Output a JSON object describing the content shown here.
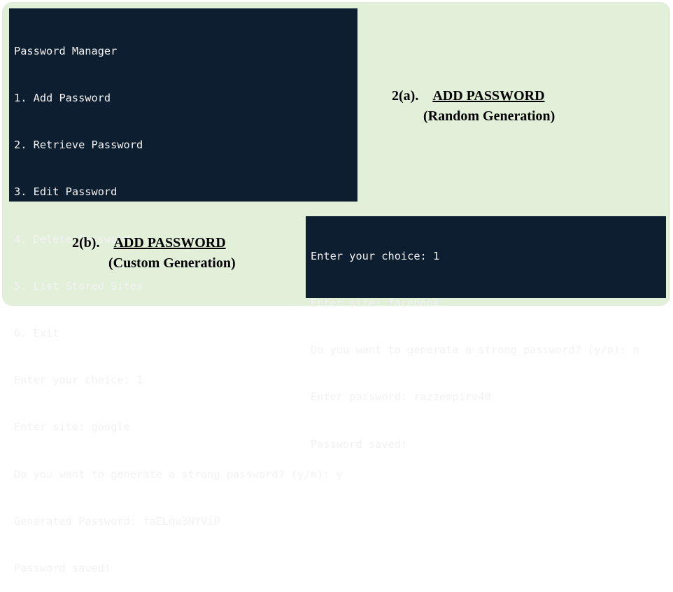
{
  "section_a": {
    "number": "2(a).",
    "title": "ADD PASSWORD",
    "subtitle": "(Random Generation)",
    "terminal_lines": [
      "Password Manager",
      "1. Add Password",
      "2. Retrieve Password",
      "3. Edit Password",
      "4. Delete Password",
      "5. List Stored Sites",
      "6. Exit",
      "Enter your choice: 1",
      "Enter site: google",
      "Do you want to generate a strong password? (y/n): y",
      "Generated Password: faELqw3NYViP",
      "Password saved!"
    ]
  },
  "section_b": {
    "number": "2(b).",
    "title": "ADD PASSWORD",
    "subtitle": "(Custom Generation)",
    "terminal_lines": [
      "Enter your choice: 1",
      "Enter site: facebook",
      "Do you want to generate a strong password? (y/n): n",
      "Enter password: razzempire40",
      "Password saved!"
    ]
  },
  "colors": {
    "panel_background": "#e2efd9",
    "terminal_background": "#0c1e30",
    "terminal_text": "#f2f2f2"
  }
}
